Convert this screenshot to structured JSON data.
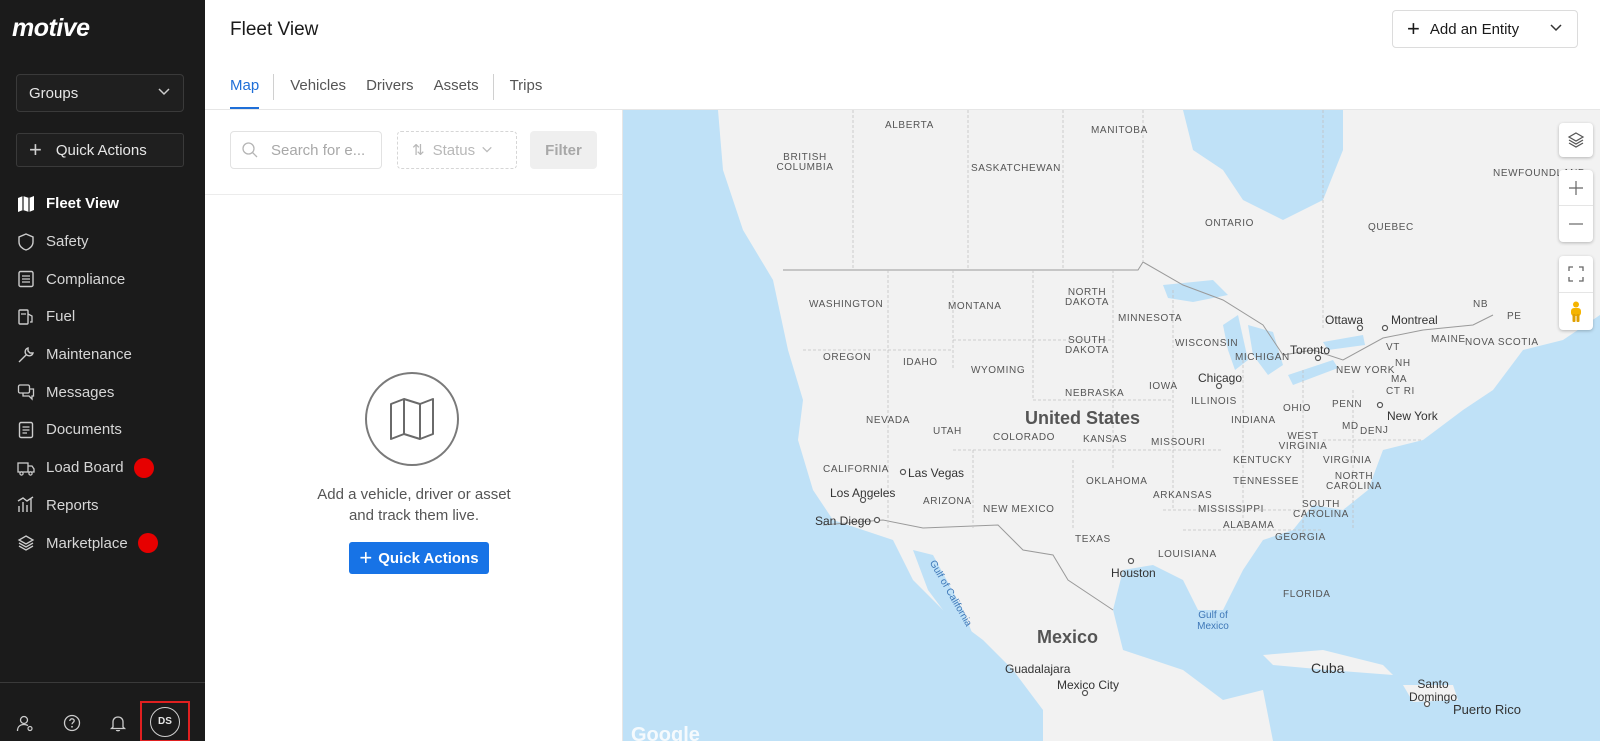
{
  "sidebar": {
    "logo": "motive",
    "groups_label": "Groups",
    "quick_actions_label": "Quick Actions",
    "items": [
      {
        "label": "Fleet View",
        "icon": "map-icon",
        "active": true,
        "badge": false
      },
      {
        "label": "Safety",
        "icon": "shield-icon",
        "active": false,
        "badge": false
      },
      {
        "label": "Compliance",
        "icon": "list-icon",
        "active": false,
        "badge": false
      },
      {
        "label": "Fuel",
        "icon": "fuel-icon",
        "active": false,
        "badge": false
      },
      {
        "label": "Maintenance",
        "icon": "wrench-icon",
        "active": false,
        "badge": false
      },
      {
        "label": "Messages",
        "icon": "chat-icon",
        "active": false,
        "badge": false
      },
      {
        "label": "Documents",
        "icon": "document-icon",
        "active": false,
        "badge": false
      },
      {
        "label": "Load Board",
        "icon": "truck-icon",
        "active": false,
        "badge": true
      },
      {
        "label": "Reports",
        "icon": "chart-icon",
        "active": false,
        "badge": false
      },
      {
        "label": "Marketplace",
        "icon": "layers-icon",
        "active": false,
        "badge": true
      }
    ],
    "avatar_initials": "DS",
    "badge_color": "#e60000"
  },
  "header": {
    "title": "Fleet View",
    "add_entity_label": "Add an Entity",
    "tabs": [
      "Map",
      "Vehicles",
      "Drivers",
      "Assets",
      "Trips"
    ],
    "active_tab": "Map",
    "accent_color": "#1f6fd8"
  },
  "panel": {
    "search_placeholder": "Search for e...",
    "status_label": "Status",
    "filter_label": "Filter",
    "empty_line1": "Add a vehicle, driver or asset",
    "empty_line2": "and track them live.",
    "quick_actions_label": "Quick Actions"
  },
  "map": {
    "regions": [
      "ALBERTA",
      "MANITOBA",
      "BRITISH COLUMBIA",
      "SASKATCHEWAN",
      "ONTARIO",
      "QUEBEC",
      "NEWFOUNDLAND",
      "WASHINGTON",
      "MONTANA",
      "NORTH DAKOTA",
      "MINNESOTA",
      "OREGON",
      "IDAHO",
      "SOUTH DAKOTA",
      "WYOMING",
      "WISCONSIN",
      "MICHIGAN",
      "NEBRASKA",
      "IOWA",
      "NEVADA",
      "UTAH",
      "COLORADO",
      "KANSAS",
      "MISSOURI",
      "ILLINOIS",
      "INDIANA",
      "OHIO",
      "PENN",
      "CALIFORNIA",
      "ARIZONA",
      "NEW MEXICO",
      "OKLAHOMA",
      "ARKANSAS",
      "TENNESSEE",
      "KENTUCKY",
      "WEST VIRGINIA",
      "VIRGINIA",
      "NORTH CAROLINA",
      "SOUTH CAROLINA",
      "MISSISSIPPI",
      "ALABAMA",
      "GEORGIA",
      "TEXAS",
      "LOUISIANA",
      "FLORIDA",
      "NEW YORK",
      "MAINE",
      "NOVA SCOTIA",
      "NB",
      "PE",
      "VT",
      "NH",
      "MA",
      "CT RI",
      "MD",
      "DE",
      "NJ"
    ],
    "cities": [
      "Ottawa",
      "Montreal",
      "Toronto",
      "Chicago",
      "Las Vegas",
      "Los Angeles",
      "San Diego",
      "Houston",
      "New York",
      "Guadalajara",
      "Mexico City",
      "Santo Domingo",
      "Puerto Rico",
      "Cuba"
    ],
    "countries": [
      "United States",
      "Mexico"
    ],
    "waters": [
      "Gulf of California",
      "Gulf of Mexico"
    ],
    "attribution": "Google"
  }
}
